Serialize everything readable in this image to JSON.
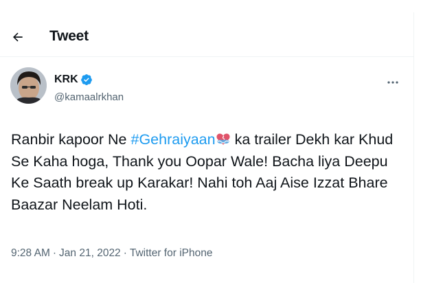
{
  "header": {
    "title": "Tweet",
    "back_icon": "arrow-left-icon"
  },
  "tweet": {
    "author": {
      "name": "KRK",
      "handle": "@kamaalrkhan",
      "verified": true,
      "verified_color": "#1d9bf0"
    },
    "text": {
      "prefix": "Ranbir kapoor Ne ",
      "hashtag": "#Gehraiyaan",
      "emoji": "heart-emoji",
      "rest": "ka trailer Dekh kar Khud Se Kaha hoga, Thank you Oopar Wale! Bacha liya Deepu Ke Saath break up Karakar! Nahi toh Aaj Aise Izzat Bhare Baazar Neelam Hoti."
    },
    "meta": {
      "time": "9:28 AM",
      "separator": "·",
      "date": "Jan 21, 2022",
      "source": "Twitter for iPhone"
    }
  },
  "colors": {
    "accent": "#1d9bf0",
    "text": "#0f1419",
    "secondary": "#536471"
  }
}
